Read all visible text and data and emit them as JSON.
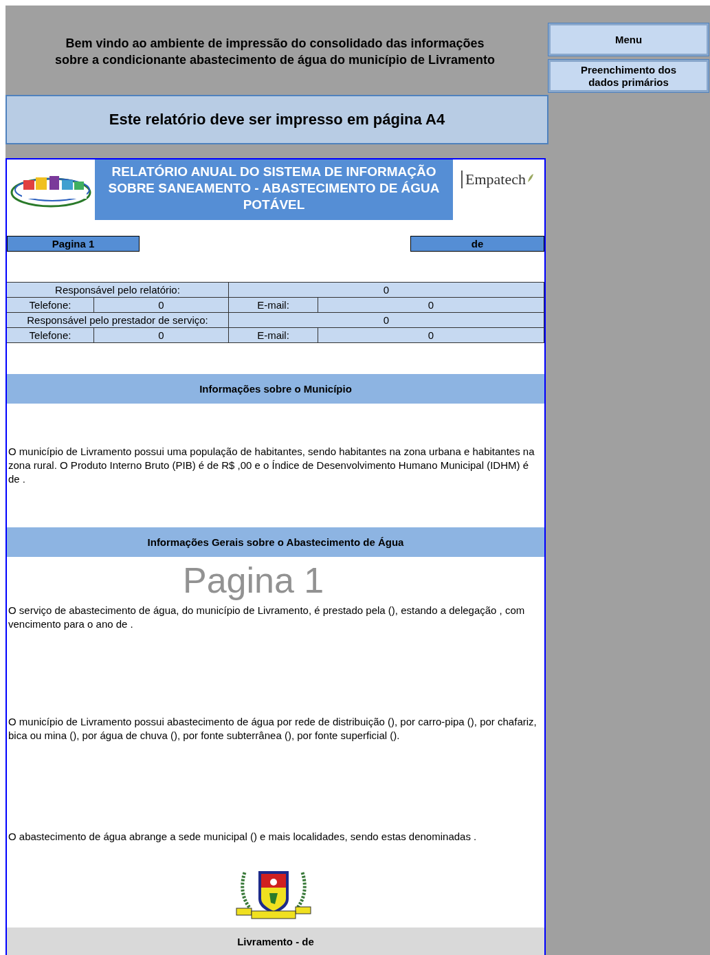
{
  "intro": "Bem vindo ao ambiente de impressão do consolidado das informações\nsobre a condicionante abastecimento de água do município de Livramento",
  "notice": "Este relatório deve ser impresso em página A4",
  "report": {
    "title": "RELATÓRIO ANUAL DO SISTEMA DE INFORMAÇÃO SOBRE SANEAMENTO - ABASTECIMENTO DE ÁGUA POTÁVEL",
    "partner_logo": "Empatech",
    "page_label": "Pagina 1",
    "page_of": "de",
    "contacts": [
      {
        "kind": "single",
        "label": "Responsável pelo relatório:",
        "value": "0"
      },
      {
        "kind": "double",
        "label": "Telefone:",
        "value": "0",
        "label2": "E-mail:",
        "value2": "0"
      },
      {
        "kind": "single",
        "label": "Responsável pelo prestador de serviço:",
        "value": "0"
      },
      {
        "kind": "double",
        "label": "Telefone:",
        "value": "0",
        "label2": "E-mail:",
        "value2": "0"
      }
    ],
    "sections": [
      {
        "heading": "Informações sobre o Município",
        "paragraphs": [
          "O município de Livramento possui uma população de  habitantes, sendo  habitantes na zona urbana e habitantes na zona rural. O Produto Interno Bruto (PIB) é de R$ ,00 e o Índice de Desenvolvimento Humano Municipal (IDHM) é de ."
        ]
      },
      {
        "heading": "Informações Gerais sobre o Abastecimento de Água",
        "paragraphs": [
          "O serviço de abastecimento de água, do município de Livramento, é prestado pela  (), estando a delegação , com vencimento para o ano de .",
          "O município de Livramento possui abastecimento de água por rede de distribuição (), por carro-pipa (), por chafariz, bica ou mina (), por água de chuva (), por fonte subterrânea (), por fonte superficial ().",
          "O abastecimento de água abrange a sede municipal () e mais  localidades, sendo estas denominadas ."
        ]
      }
    ],
    "footer": "Livramento -  de",
    "watermark": "Pagina 1"
  },
  "side_buttons": [
    "Menu",
    "Preenchimento dos dados primários"
  ]
}
